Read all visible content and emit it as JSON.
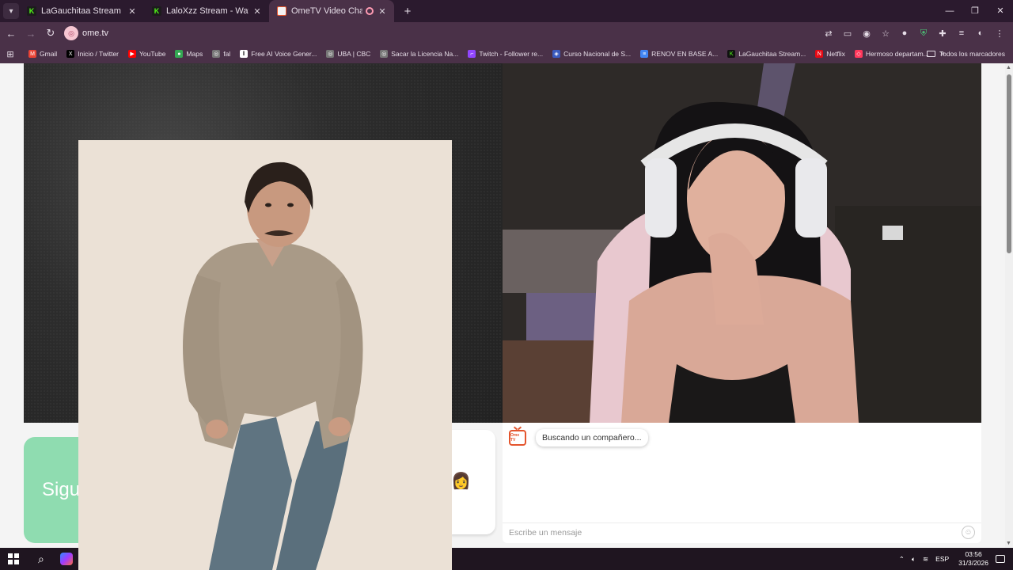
{
  "browser": {
    "tabs": [
      {
        "title": "LaGauchitaa Stream - Watch Liv",
        "favicon": "kick-icon",
        "active": false
      },
      {
        "title": "LaloXzz Stream - Watch Live on",
        "favicon": "kick-icon",
        "active": false
      },
      {
        "title": "OmeTV Video Chat — Ome",
        "favicon": "ometv-icon",
        "active": true,
        "recording": true
      }
    ],
    "url": "ome.tv",
    "window_controls": [
      "minimize-icon",
      "restore-icon",
      "close-icon"
    ]
  },
  "bookmarks": [
    {
      "label": "Gmail",
      "icon": "gmail-icon",
      "color": "#ea4335"
    },
    {
      "label": "Inicio / Twitter",
      "icon": "x-icon",
      "color": "#000000"
    },
    {
      "label": "YouTube",
      "icon": "youtube-icon",
      "color": "#ff0000"
    },
    {
      "label": "Maps",
      "icon": "maps-icon",
      "color": "#34a853"
    },
    {
      "label": "fal",
      "icon": "globe-icon",
      "color": "#888888"
    },
    {
      "label": "Free AI Voice Gener...",
      "icon": "ai-voice-icon",
      "color": "#ffffff"
    },
    {
      "label": "UBA | CBC",
      "icon": "globe-icon",
      "color": "#888888"
    },
    {
      "label": "Sacar la Licencia Na...",
      "icon": "globe-icon",
      "color": "#888888"
    },
    {
      "label": "Twitch - Follower re...",
      "icon": "twitch-icon",
      "color": "#9146ff"
    },
    {
      "label": "Curso Nacional de S...",
      "icon": "shield-badge-icon",
      "color": "#3a5bbf"
    },
    {
      "label": "RENOV EN BASE A...",
      "icon": "docs-icon",
      "color": "#4285f4"
    },
    {
      "label": "LaGauchitaa Stream...",
      "icon": "kick-icon",
      "color": "#53fc18"
    },
    {
      "label": "Netflix",
      "icon": "netflix-icon",
      "color": "#e50914"
    },
    {
      "label": "Hermoso departam...",
      "icon": "airbnb-icon",
      "color": "#ff385c"
    }
  ],
  "bookmarks_more": "»",
  "bookmarks_all": "Todos los marcadores",
  "ometv": {
    "next_button": "Sigu",
    "status_message": "Buscando un compañero...",
    "message_placeholder": "Escribe un mensaje",
    "logo_text": "Ome TV"
  },
  "taskbar": {
    "language": "ESP",
    "time": "03:56",
    "date": "31/3/2026"
  },
  "colors": {
    "accent_green": "#8fdcb0",
    "ome_orange": "#e4552d",
    "chrome_dark": "#2b1a2e",
    "chrome_toolbar": "#4a3148"
  }
}
